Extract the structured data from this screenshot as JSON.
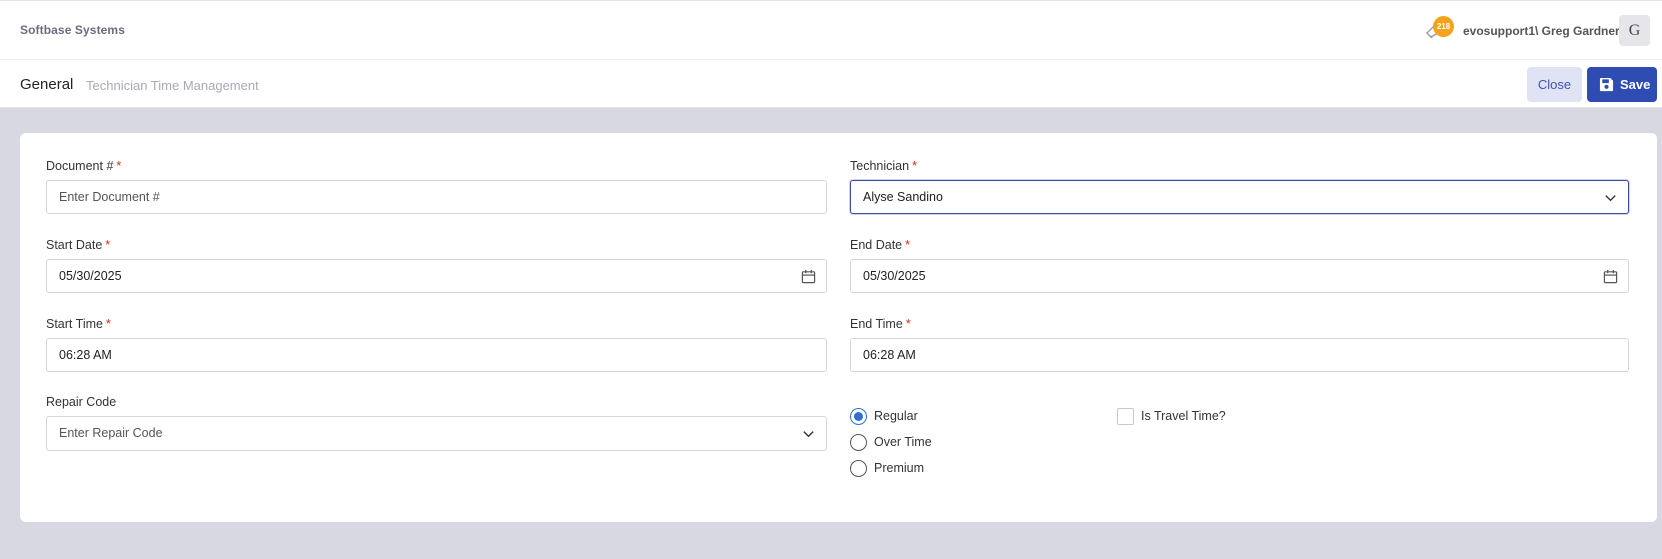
{
  "header": {
    "company": "Softbase Systems",
    "notification_count": "218",
    "user": "evosupport1\\ Greg Gardner",
    "avatar_initial": "G"
  },
  "subheader": {
    "title": "General",
    "breadcrumb": "Technician Time Management",
    "close_label": "Close",
    "save_label": "Save"
  },
  "form": {
    "document": {
      "label": "Document #",
      "required": "*",
      "placeholder": "Enter Document #",
      "value": ""
    },
    "technician": {
      "label": "Technician",
      "required": "*",
      "value": "Alyse Sandino"
    },
    "start_date": {
      "label": "Start Date",
      "required": "*",
      "value": "05/30/2025"
    },
    "end_date": {
      "label": "End Date",
      "required": "*",
      "value": "05/30/2025"
    },
    "start_time": {
      "label": "Start Time",
      "required": "*",
      "value": "06:28 AM"
    },
    "end_time": {
      "label": "End Time",
      "required": "*",
      "value": "06:28 AM"
    },
    "repair_code": {
      "label": "Repair Code",
      "placeholder": "Enter Repair Code"
    },
    "time_type": {
      "options": [
        "Regular",
        "Over Time",
        "Premium"
      ],
      "selected": "Regular"
    },
    "travel_time": {
      "label": "Is Travel Time?",
      "checked": false
    }
  },
  "colors": {
    "primary": "#2f4cb3",
    "accent_badge": "#f5a31a",
    "required": "#e02424",
    "page_bg": "#d8d8e2"
  }
}
